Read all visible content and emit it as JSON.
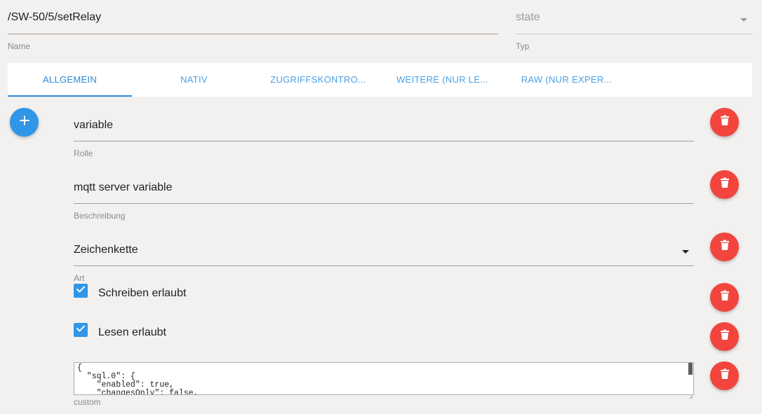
{
  "header": {
    "name_value": "/SW-50/5/setRelay",
    "name_label": "Name",
    "type_value": "state",
    "type_label": "Typ"
  },
  "tabs": [
    {
      "label": "ALLGEMEIN",
      "active": true
    },
    {
      "label": "NATIV",
      "active": false
    },
    {
      "label": "ZUGRIFFSKONTRO...",
      "active": false
    },
    {
      "label": "WEITERE (NUR LE...",
      "active": false
    },
    {
      "label": "RAW (NUR EXPER...",
      "active": false
    }
  ],
  "fields": {
    "role": {
      "value": "variable",
      "label": "Rolle"
    },
    "description": {
      "value": "mqtt server variable",
      "label": "Beschreibung"
    },
    "kind": {
      "value": "Zeichenkette",
      "label": "Art"
    },
    "write": {
      "label": "Schreiben erlaubt",
      "checked": true
    },
    "read": {
      "label": "Lesen erlaubt",
      "checked": true
    },
    "custom": {
      "value": "{\n  \"sql.0\": {\n    \"enabled\": true,\n    \"changesOnly\": false,",
      "label": "custom"
    }
  },
  "icons": {
    "add": "plus-icon",
    "delete": "trash-icon",
    "dropdown": "caret-down-icon",
    "check": "checkmark-icon"
  },
  "colors": {
    "accent_blue": "#2f96e8",
    "tab_text": "#4aa0e6",
    "delete_red": "#f2453d",
    "background": "#f3f1ef"
  }
}
